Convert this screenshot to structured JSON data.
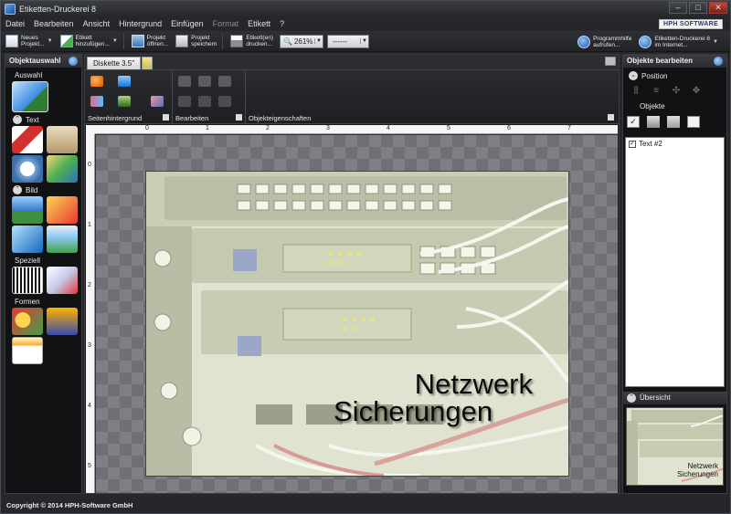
{
  "window": {
    "title": "Etiketten-Druckerei 8",
    "brand": "HPH SOFTWARE"
  },
  "menu": {
    "items": [
      {
        "label": "Datei",
        "enabled": true
      },
      {
        "label": "Bearbeiten",
        "enabled": true
      },
      {
        "label": "Ansicht",
        "enabled": true
      },
      {
        "label": "Hintergrund",
        "enabled": true
      },
      {
        "label": "Einfügen",
        "enabled": true
      },
      {
        "label": "Format",
        "enabled": false
      },
      {
        "label": "Etikett",
        "enabled": true
      },
      {
        "label": "?",
        "enabled": true
      }
    ]
  },
  "toolbar": {
    "new_project": "Neues\nProjekt...",
    "add_label": "Etikett\nhinzufügen...",
    "open_project": "Projekt\nöffnen...",
    "save_project": "Projekt\nspeichern",
    "print_labels": "Etikett(en)\ndrucken...",
    "zoom": "261%",
    "line_style": "------",
    "help": "Programmhilfe\naufrufen...",
    "online": "Etiketten-Druckerei 8\nim Internet..."
  },
  "left_panel": {
    "title": "Objektauswahl",
    "section_selection": "Auswahl",
    "section_text": "Text",
    "section_image": "Bild",
    "section_special": "Speziell",
    "section_shapes": "Formen"
  },
  "document": {
    "tab_label": "Diskette 3.5\"",
    "ribbon_groups": {
      "background": "Seitenhintergrund",
      "edit": "Bearbeiten",
      "properties": "Objekteigenschaften"
    },
    "ruler_h": [
      "0",
      "1",
      "2",
      "3",
      "4",
      "5",
      "6",
      "7"
    ],
    "ruler_v": [
      "0",
      "1",
      "2",
      "3",
      "4",
      "5"
    ],
    "label_text_line1": "Netzwerk",
    "label_text_line2": "Sicherungen"
  },
  "right_panel": {
    "title": "Objekte bearbeiten",
    "section_position": "Position",
    "section_objects": "Objekte",
    "object_items": [
      {
        "label": "Text #2",
        "checked": true
      }
    ],
    "section_overview": "Übersicht",
    "overview_line1": "Netzwerk",
    "overview_line2": "Sicherungen"
  },
  "statusbar": {
    "copyright": "Copyright © 2014 HPH-Software GmbH"
  },
  "colors": {
    "app_background": "#26272b",
    "panel_background": "#111214",
    "label_background": "#e8ebd6",
    "accent_blue": "#2a6fc4"
  }
}
